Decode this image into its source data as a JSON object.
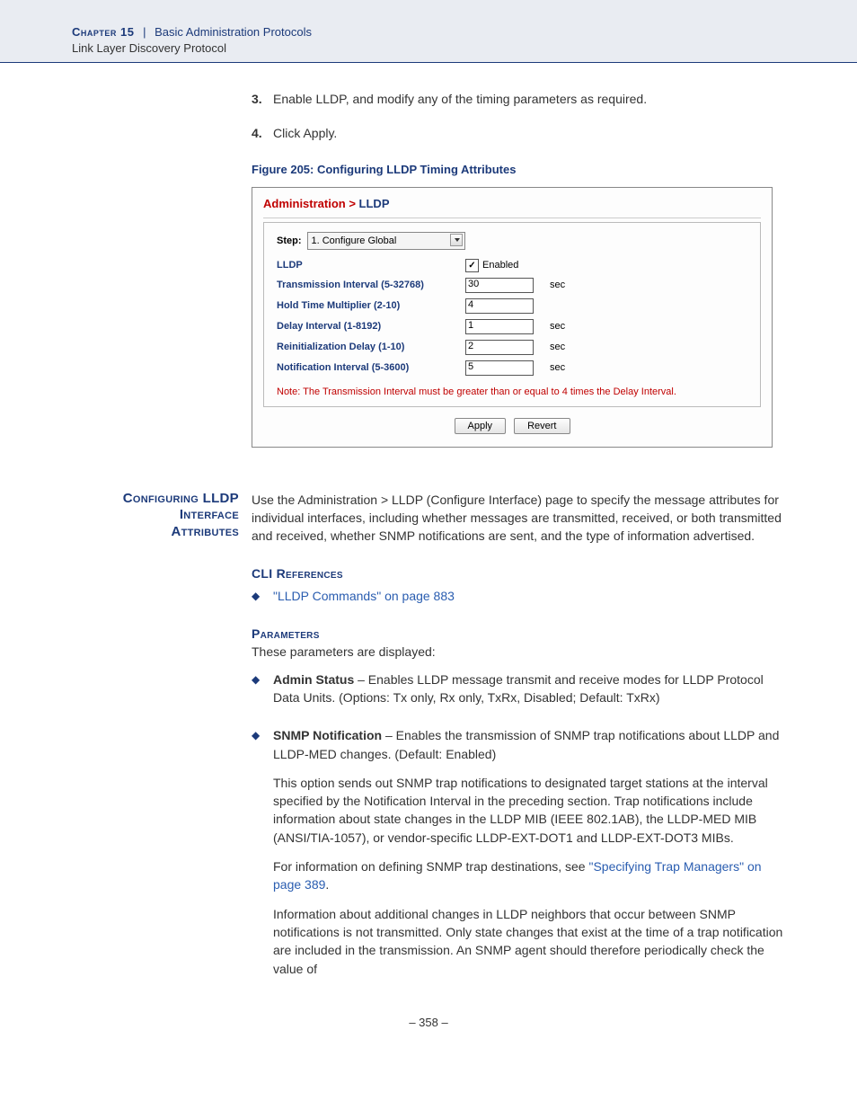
{
  "header": {
    "chapter": "Chapter 15",
    "section": "Basic Administration Protocols",
    "subsection": "Link Layer Discovery Protocol"
  },
  "steps": {
    "s3": {
      "num": "3.",
      "text": "Enable LLDP, and modify any of the timing parameters as required."
    },
    "s4": {
      "num": "4.",
      "text": "Click Apply."
    }
  },
  "figure": {
    "caption": "Figure 205:  Configuring LLDP Timing Attributes",
    "breadcrumb_root": "Administration >",
    "breadcrumb_leaf": " LLDP",
    "step_label": "Step:",
    "step_value": "1. Configure Global",
    "rows": {
      "lldp": {
        "label": "LLDP",
        "enabled_text": "Enabled"
      },
      "ti": {
        "label": "Transmission Interval (5-32768)",
        "value": "30",
        "unit": "sec"
      },
      "htm": {
        "label": "Hold Time Multiplier (2-10)",
        "value": "4"
      },
      "di": {
        "label": "Delay Interval (1-8192)",
        "value": "1",
        "unit": "sec"
      },
      "rd": {
        "label": "Reinitialization Delay (1-10)",
        "value": "2",
        "unit": "sec"
      },
      "ni": {
        "label": "Notification Interval (5-3600)",
        "value": "5",
        "unit": "sec"
      }
    },
    "note": "Note: The Transmission Interval must be greater than or equal to 4 times the Delay Interval.",
    "apply": "Apply",
    "revert": "Revert"
  },
  "section2": {
    "title_line1": "Configuring LLDP",
    "title_line2": "Interface",
    "title_line3": "Attributes",
    "intro": "Use the Administration > LLDP (Configure Interface) page to specify the message attributes for individual interfaces, including whether messages are transmitted, received, or both transmitted and received, whether SNMP notifications are sent, and the type of information advertised.",
    "cli_head": "CLI References",
    "cli_link": "\"LLDP Commands\" on page 883",
    "params_head": "Parameters",
    "params_intro": "These parameters are displayed:",
    "admin_status_label": "Admin Status",
    "admin_status_text": " – Enables LLDP message transmit and receive modes for LLDP Protocol Data Units. (Options: Tx only, Rx only, TxRx, Disabled; Default: TxRx)",
    "snmp_label": "SNMP Notification",
    "snmp_text1": " – Enables the transmission of SNMP trap notifications about LLDP and LLDP-MED changes. (Default: Enabled)",
    "snmp_p2": "This option sends out SNMP trap notifications to designated target stations at the interval specified by the Notification Interval in the preceding section. Trap notifications include information about state changes in the LLDP MIB (IEEE 802.1AB), the LLDP-MED MIB (ANSI/TIA-1057), or vendor-specific LLDP-EXT-DOT1 and LLDP-EXT-DOT3 MIBs.",
    "snmp_p3a": "For information on defining SNMP trap destinations, see ",
    "snmp_p3_link": "\"Specifying Trap Managers\" on page 389",
    "snmp_p3b": ".",
    "snmp_p4": "Information about additional changes in LLDP neighbors that occur between SNMP notifications is not transmitted. Only state changes that exist at the time of a trap notification are included in the transmission. An SNMP agent should therefore periodically check the value of"
  },
  "page_number": "–  358  –"
}
